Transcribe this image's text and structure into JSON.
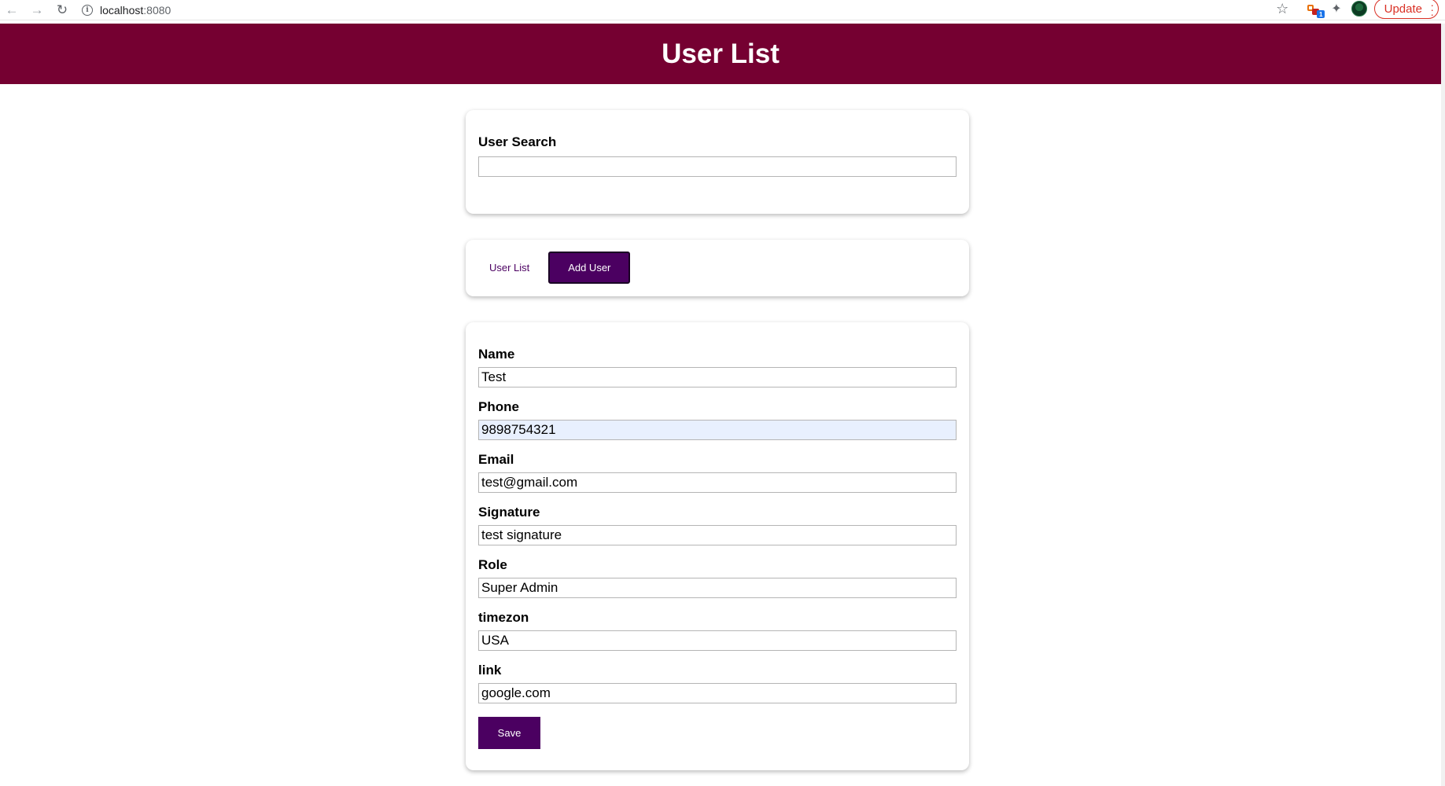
{
  "browser": {
    "url_host": "localhost",
    "url_port": ":8080",
    "extension_badge": "1",
    "update_label": "Update"
  },
  "header": {
    "title": "User List"
  },
  "search": {
    "label": "User Search",
    "value": ""
  },
  "tabs": {
    "list_label": "User List",
    "add_label": "Add User",
    "active": "Add User"
  },
  "form": {
    "fields": [
      {
        "label": "Name",
        "value": "Test"
      },
      {
        "label": "Phone",
        "value": "9898754321"
      },
      {
        "label": "Email",
        "value": "test@gmail.com"
      },
      {
        "label": "Signature",
        "value": "test signature"
      },
      {
        "label": "Role",
        "value": "Super Admin"
      },
      {
        "label": "timezon",
        "value": "USA"
      },
      {
        "label": "link",
        "value": "google.com"
      }
    ],
    "save_label": "Save"
  },
  "colors": {
    "header_bg": "#750031",
    "primary_button": "#4b0061",
    "autofill_bg": "#e8f0fe"
  },
  "icons": [
    "back-arrow-icon",
    "forward-arrow-icon",
    "reload-icon",
    "info-icon",
    "star-icon",
    "extension-icon",
    "puzzle-icon",
    "avatar",
    "menu-dots-icon"
  ]
}
